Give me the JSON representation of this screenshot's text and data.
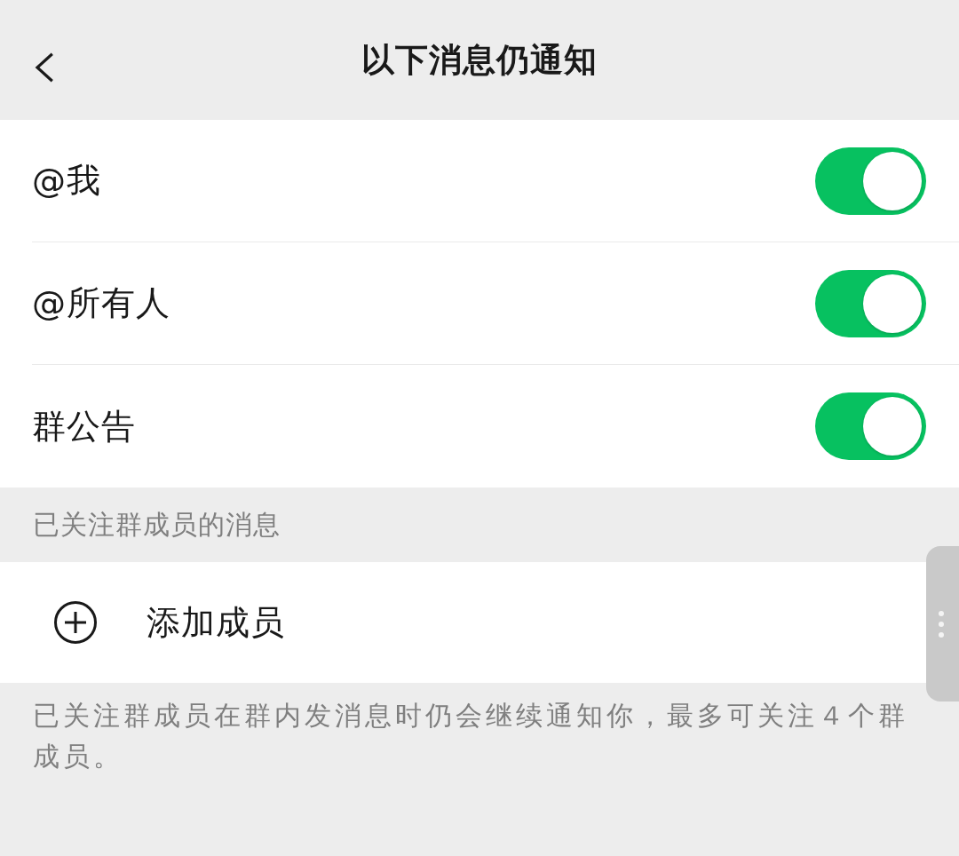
{
  "header": {
    "title": "以下消息仍通知"
  },
  "settings": [
    {
      "label": "@我",
      "on": true
    },
    {
      "label": "@所有人",
      "on": true
    },
    {
      "label": "群公告",
      "on": true
    }
  ],
  "followed_section": {
    "title": "已关注群成员的消息",
    "add_label": "添加成员",
    "note": "已关注群成员在群内发消息时仍会继续通知你，最多可关注４个群成员。"
  }
}
